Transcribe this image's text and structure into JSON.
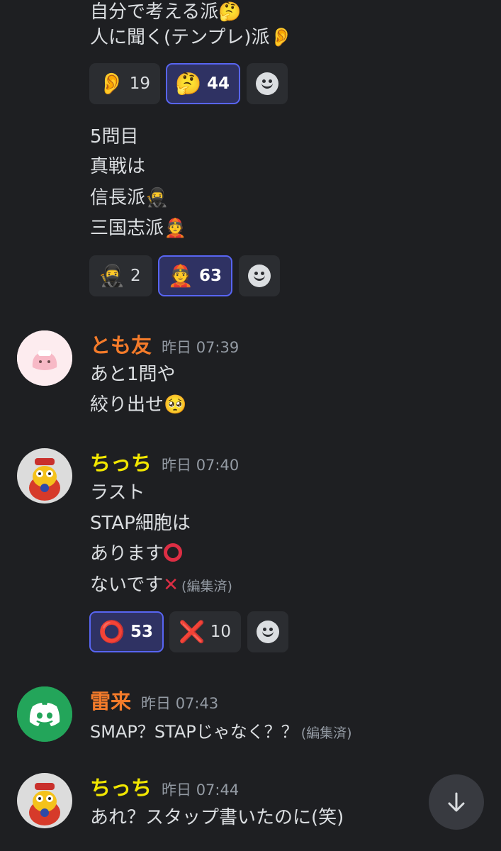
{
  "messages": {
    "q4": {
      "line1": "自分で考える派🤔",
      "line2": "人に聞く(テンプレ)派👂"
    },
    "q4_reactions": [
      {
        "emoji": "👂",
        "count": "19",
        "active": false
      },
      {
        "emoji": "🤔",
        "count": "44",
        "active": true
      }
    ],
    "q5": {
      "line1": "5問目",
      "line2": "真戦は",
      "line3": "信長派🥷",
      "line4": "三国志派👲"
    },
    "q5_reactions": [
      {
        "emoji": "🥷",
        "count": "2",
        "active": false
      },
      {
        "emoji": "👲",
        "count": "63",
        "active": true
      }
    ],
    "tomo": {
      "username": "とも友",
      "timestamp": "昨日 07:39",
      "line1": "あと1問や",
      "line2": "絞り出せ🥺",
      "name_color": "#f47b2a"
    },
    "chicchi1": {
      "username": "ちっち",
      "timestamp": "昨日 07:40",
      "line1": "ラスト",
      "line2": "STAP細胞は",
      "line3": "あります",
      "line4": "ないです",
      "edited": "(編集済)",
      "name_color": "#f1e600"
    },
    "chicchi1_reactions": [
      {
        "emoji": "⭕",
        "count": "53",
        "active": true
      },
      {
        "emoji": "❌",
        "count": "10",
        "active": false
      }
    ],
    "raira": {
      "username": "雷来",
      "timestamp": "昨日 07:43",
      "line1": "SMAP？STAPじゃなく？？",
      "edited": "(編集済)",
      "name_color": "#f47b2a"
    },
    "chicchi2": {
      "username": "ちっち",
      "timestamp": "昨日 07:44",
      "line1": "あれ？スタップ書いたのに(笑)",
      "name_color": "#f1e600"
    }
  },
  "icons": {
    "add_reaction": "smiley-icon",
    "scroll_down": "arrow-down-icon",
    "discord_avatar": "discord-logo-icon"
  },
  "colors": {
    "background": "#1e1f22",
    "accent": "#5865f2",
    "discord_green": "#23a55a"
  }
}
